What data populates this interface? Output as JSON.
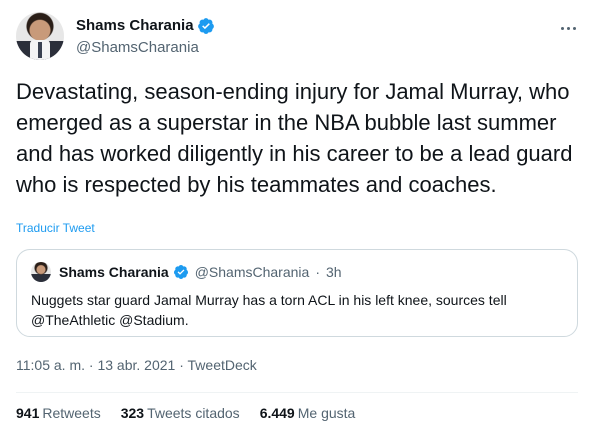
{
  "author": {
    "display_name": "Shams Charania",
    "handle": "@ShamsCharania",
    "verified_icon": "verified-badge-icon"
  },
  "tweet": {
    "text": "Devastating, season-ending injury for Jamal Murray, who emerged as a superstar in the NBA bubble last summer and has worked diligently in his career to be a lead guard who is respected by his teammates and coaches.",
    "translate_label": "Traducir Tweet"
  },
  "quoted_tweet": {
    "display_name": "Shams Charania",
    "handle": "@ShamsCharania",
    "separator": "·",
    "time": "3h",
    "text": "Nuggets star guard Jamal Murray has a torn ACL in his left knee, sources tell @TheAthletic @Stadium."
  },
  "meta": {
    "time": "11:05 a. m.",
    "separator1": "·",
    "date": "13 abr. 2021",
    "separator2": "·",
    "source": "TweetDeck"
  },
  "stats": [
    {
      "count": "941",
      "label": "Retweets"
    },
    {
      "count": "323",
      "label": "Tweets citados"
    },
    {
      "count": "6.449",
      "label": "Me gusta"
    }
  ],
  "colors": {
    "accent": "#1d9bf0",
    "text": "#0f1419",
    "secondary": "#536471",
    "border": "#cfd9de"
  }
}
